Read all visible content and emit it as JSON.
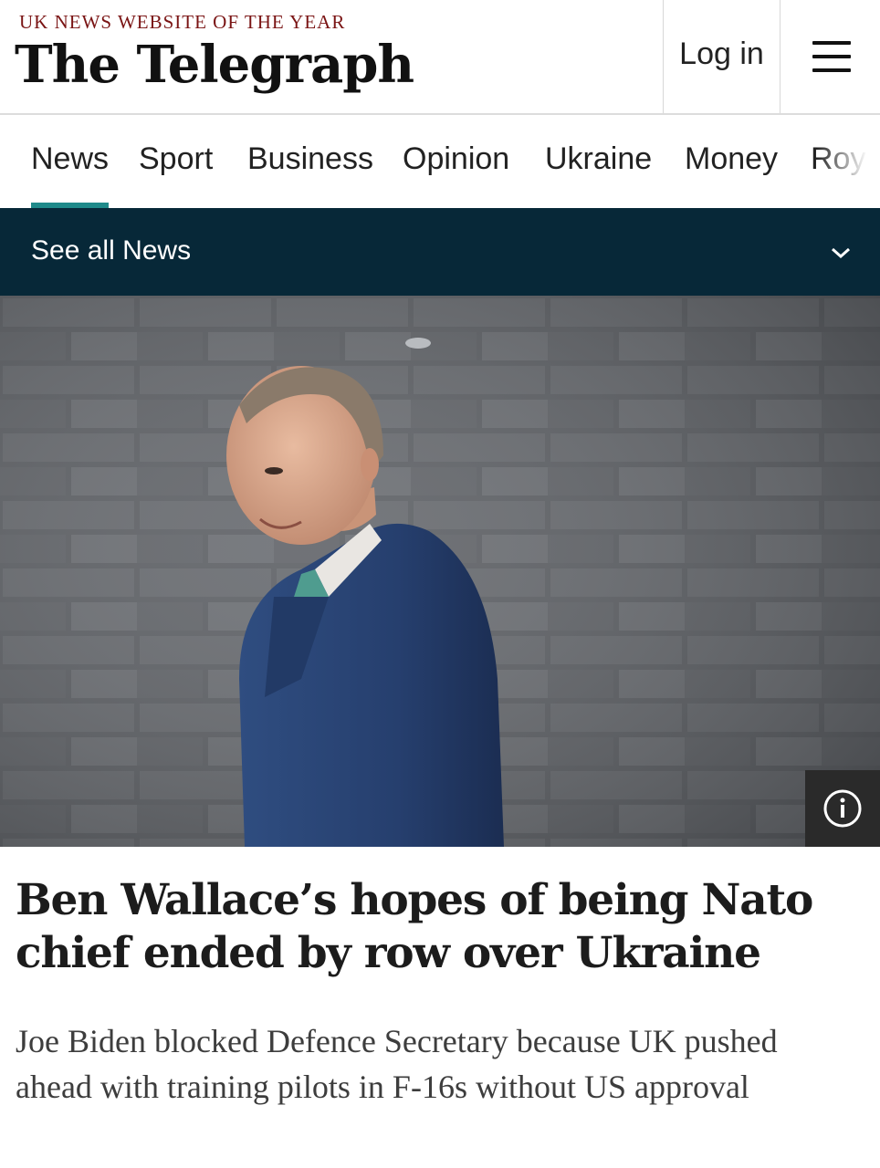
{
  "header": {
    "tagline": "UK NEWS WEBSITE OF THE YEAR",
    "logo": "The Telegraph",
    "login_label": "Log in",
    "menu_icon": "hamburger-menu-icon"
  },
  "nav": {
    "items": [
      {
        "label": "News",
        "active": true
      },
      {
        "label": "Sport"
      },
      {
        "label": "Business"
      },
      {
        "label": "Opinion"
      },
      {
        "label": "Ukraine"
      },
      {
        "label": "Money"
      },
      {
        "label": "Roy"
      }
    ],
    "accent_color": "#1f8a8a"
  },
  "subnav": {
    "label": "See all News",
    "icon": "chevron-down-icon",
    "background": "#072838"
  },
  "hero": {
    "info_icon": "info-icon"
  },
  "article": {
    "headline": "Ben Wallace’s hopes of being Nato chief ended by row over Ukraine",
    "standfirst": "Joe Biden blocked Defence Secretary because UK pushed ahead with training pilots in F-16s without US approval"
  }
}
